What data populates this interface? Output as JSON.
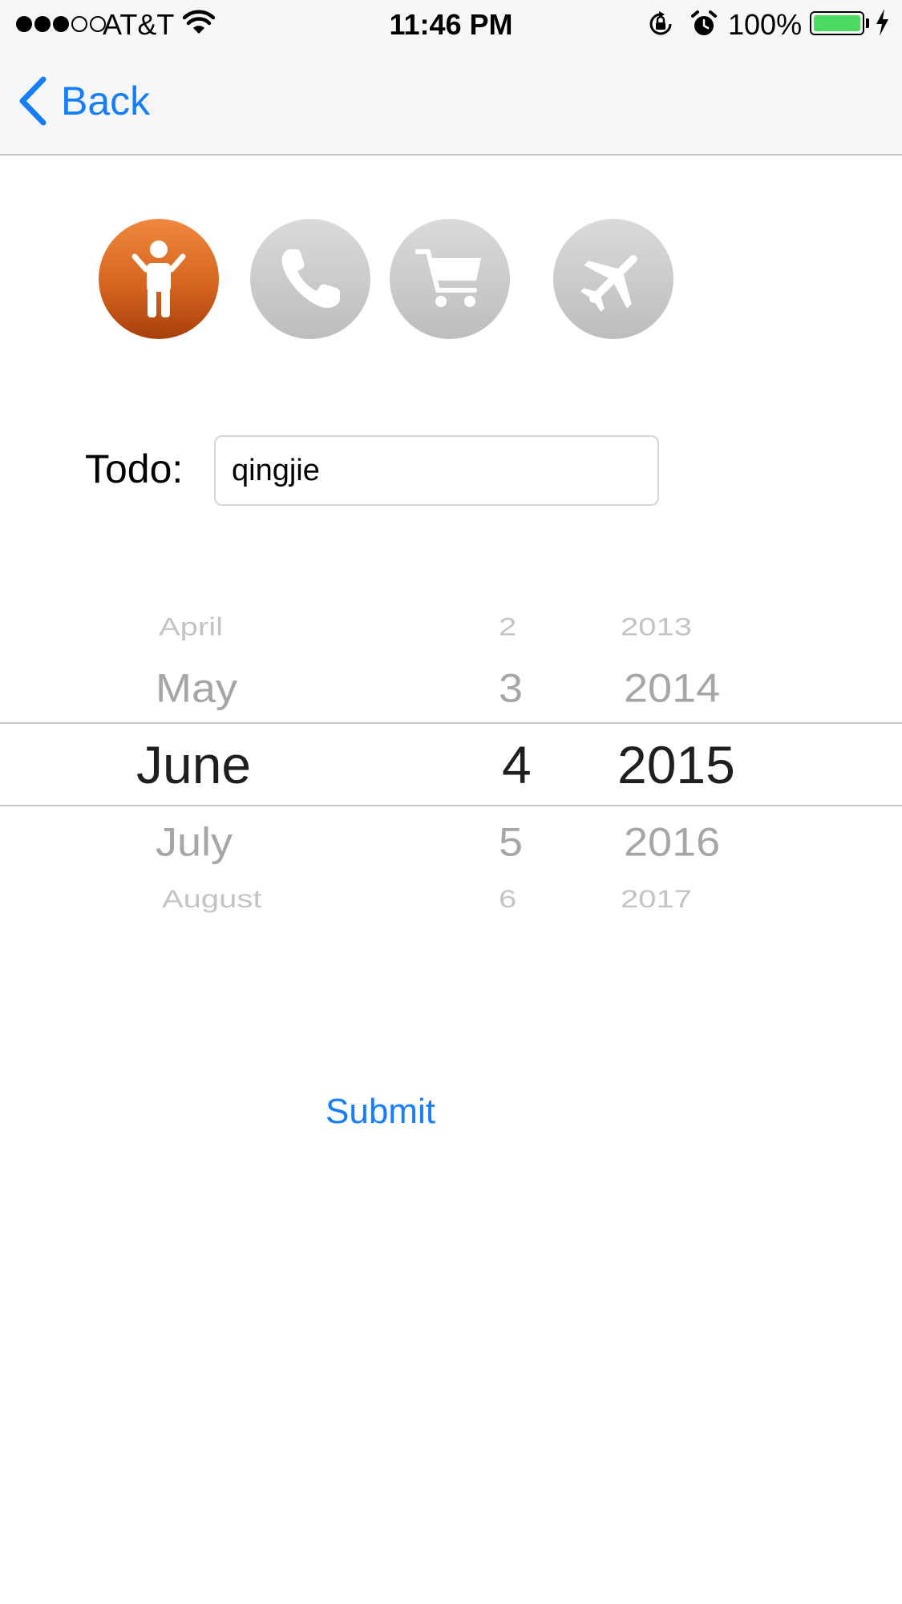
{
  "status_bar": {
    "carrier": "AT&T",
    "time": "11:46 PM",
    "battery_percent": "100%",
    "signal_strength": 3,
    "signal_max": 5,
    "battery_color": "#4cd964"
  },
  "nav": {
    "back_label": "Back",
    "accent_color": "#157efb"
  },
  "categories": [
    {
      "icon": "person-icon",
      "selected": true
    },
    {
      "icon": "phone-icon",
      "selected": false
    },
    {
      "icon": "cart-icon",
      "selected": false
    },
    {
      "icon": "airplane-icon",
      "selected": false
    }
  ],
  "todo": {
    "label": "Todo:",
    "value": "qingjie"
  },
  "date_picker": {
    "months": [
      "April",
      "May",
      "June",
      "July",
      "August"
    ],
    "days": [
      "2",
      "3",
      "4",
      "5",
      "6"
    ],
    "years": [
      "2013",
      "2014",
      "2015",
      "2016",
      "2017"
    ],
    "selected": {
      "month": "June",
      "day": "4",
      "year": "2015"
    }
  },
  "submit_label": "Submit"
}
